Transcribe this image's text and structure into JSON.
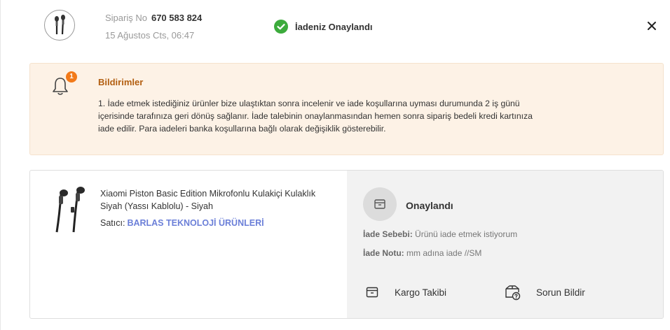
{
  "header": {
    "order_label": "Sipariş No",
    "order_number": "670 583 824",
    "date": "15 Ağustos Cts, 06:47",
    "status_text": "İadeniz Onaylandı",
    "status_color": "#3cab3c"
  },
  "notification": {
    "badge_count": "1",
    "title": "Bildirimler",
    "text": "1. İade etmek istediğiniz ürünler bize ulaştıktan sonra incelenir ve iade koşullarına uyması durumunda 2 iş günü içerisinde tarafınıza geri dönüş sağlanır. İade talebinin onaylanmasından hemen sonra sipariş bedeli kredi kartınıza iade edilir. Para iadeleri banka koşullarına bağlı olarak değişiklik gösterebilir.",
    "accent_color": "#f27a1a"
  },
  "product": {
    "name": "Xiaomi Piston Basic Edition Mikrofonlu Kulakiçi Kulaklık Siyah (Yassı Kablolu) - Siyah",
    "seller_label": "Satıcı:",
    "seller_name": "BARLAS TEKNOLOJİ ÜRÜNLERİ"
  },
  "return_info": {
    "state": "Onaylandı",
    "reason_label": "İade Sebebi:",
    "reason_value": "Ürünü iade etmek istiyorum",
    "note_label": "İade Notu:",
    "note_value": "mm adına iade //SM"
  },
  "actions": {
    "cargo_label": "Kargo Takibi",
    "issue_label": "Sorun Bildir"
  },
  "icons": [
    "earphone-thumbnail",
    "check-circle-icon",
    "close-icon",
    "bell-icon",
    "box-icon",
    "box-question-icon"
  ]
}
